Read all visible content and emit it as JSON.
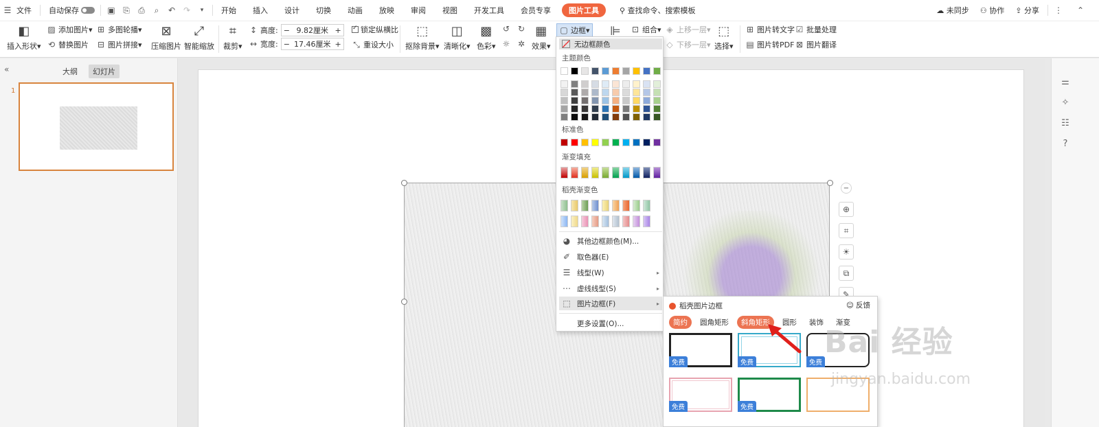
{
  "menubar": {
    "file": "文件",
    "autosave": "自动保存",
    "tabs": [
      "开始",
      "插入",
      "设计",
      "切换",
      "动画",
      "放映",
      "审阅",
      "视图",
      "开发工具",
      "会员专享",
      "图片工具"
    ],
    "search_placeholder": "查找命令、搜索模板",
    "unsynced": "未同步",
    "collab": "协作",
    "share": "分享"
  },
  "ribbon": {
    "insert_shape": "插入形状",
    "add_picture": "添加图片",
    "replace_picture": "替换图片",
    "multi_carousel": "多图轮播",
    "picture_mosaic": "图片拼接",
    "compress": "压缩图片",
    "smart_zoom": "智能缩放",
    "crop": "裁剪",
    "height_label": "高度:",
    "height_value": "9.82厘米",
    "width_label": "宽度:",
    "width_value": "17.46厘米",
    "lock_ratio": "锁定纵横比",
    "reset_size": "重设大小",
    "remove_bg": "抠除背景",
    "sharpen": "清晰化",
    "color": "色彩",
    "effects": "效果",
    "border": "边框",
    "combine": "组合",
    "bring_forward": "上移一层",
    "send_backward": "下移一层",
    "select": "选择",
    "pic_to_text": "图片转文字",
    "batch": "批量处理",
    "pic_to_pdf": "图片转PDF",
    "pic_translate": "图片翻译"
  },
  "leftpanel": {
    "tab_outline": "大纲",
    "tab_slides": "幻灯片",
    "slide_number": "1"
  },
  "dropdown": {
    "no_border": "无边框颜色",
    "theme_colors": "主题颜色",
    "standard_colors": "标准色",
    "gradient_fill": "渐变填充",
    "docer_gradient": "稻壳渐变色",
    "other_colors": "其他边框颜色(M)...",
    "eyedropper": "取色器(E)",
    "line_type": "线型(W)",
    "dash_type": "虚线线型(S)",
    "picture_border": "图片边框(F)",
    "more_settings": "更多设置(O)...",
    "theme_top": [
      "#ffffff",
      "#000000",
      "#e7e6e6",
      "#44546a",
      "#5b9bd5",
      "#ed7d31",
      "#a5a5a5",
      "#ffc000",
      "#4472c4",
      "#70ad47"
    ],
    "theme_shades": [
      [
        "#f2f2f2",
        "#7f7f7f",
        "#d0cece",
        "#d6dce4",
        "#deebf6",
        "#fbe5d5",
        "#ededed",
        "#fff2cc",
        "#d9e2f3",
        "#e2efd9"
      ],
      [
        "#d8d8d8",
        "#595959",
        "#aeaaaa",
        "#adb9ca",
        "#bdd7ee",
        "#f7cbac",
        "#dbdbdb",
        "#fee599",
        "#b4c6e7",
        "#c5e0b3"
      ],
      [
        "#bfbfbf",
        "#3f3f3f",
        "#757070",
        "#8496b0",
        "#9cc3e5",
        "#f4b183",
        "#c9c9c9",
        "#ffd965",
        "#8eaadb",
        "#a8d08d"
      ],
      [
        "#a5a5a5",
        "#262626",
        "#3a3838",
        "#323f4f",
        "#2e75b5",
        "#c55a11",
        "#7b7b7b",
        "#bf9000",
        "#2f5496",
        "#538135"
      ],
      [
        "#7f7f7f",
        "#0c0c0c",
        "#171616",
        "#222a35",
        "#1e4e79",
        "#833c0b",
        "#525252",
        "#7f6000",
        "#1f3864",
        "#375623"
      ]
    ],
    "standard": [
      "#c00000",
      "#ff0000",
      "#ffc000",
      "#ffff00",
      "#92d050",
      "#00b050",
      "#00b0f0",
      "#0070c0",
      "#002060",
      "#7030a0"
    ],
    "gradients": [
      [
        "#e8a0a0",
        "#c00000"
      ],
      [
        "#f7b0a0",
        "#e03020"
      ],
      [
        "#f3d38a",
        "#d7a000"
      ],
      [
        "#f0ec90",
        "#c8c000"
      ],
      [
        "#c8e09a",
        "#78a830"
      ],
      [
        "#8ad6a4",
        "#00a050"
      ],
      [
        "#8ad6ec",
        "#0098c8"
      ],
      [
        "#90b8e0",
        "#0058a8"
      ],
      [
        "#8090b8",
        "#102060"
      ],
      [
        "#b890d8",
        "#6020a0"
      ]
    ],
    "docer_row1": [
      [
        "#c9e2c9",
        "#8fbf8f"
      ],
      [
        "#f6e7b0",
        "#e9c96a"
      ],
      [
        "#b9d3a8",
        "#6e9e55"
      ],
      [
        "#b8cbe9",
        "#6f8fcf"
      ],
      [
        "#fbf1b5",
        "#e8d27a"
      ],
      [
        "#f8d5a4",
        "#f0a055"
      ],
      [
        "#f6a37a",
        "#e8662f"
      ],
      [
        "#d6ecd0",
        "#9acb8a"
      ],
      [
        "#cfe7d9",
        "#8ec4a3"
      ]
    ],
    "docer_row2": [
      [
        "#cfe2fb",
        "#8bb6f2"
      ],
      [
        "#fbf1c4",
        "#efd98a"
      ],
      [
        "#f6cbdc",
        "#ea93b6"
      ],
      [
        "#f6cfc0",
        "#e49a85"
      ],
      [
        "#d8e6f3",
        "#a4c0dd"
      ],
      [
        "#dfe6ee",
        "#b3c1cf"
      ],
      [
        "#f4c5c5",
        "#e38b8b"
      ],
      [
        "#e6d1f0",
        "#c38fdb"
      ],
      [
        "#d7c6f4",
        "#a985e6"
      ]
    ]
  },
  "subpanel": {
    "title": "稻壳图片边框",
    "feedback": "反馈",
    "tabs": [
      "简约",
      "圆角矩形",
      "斜角矩形",
      "圆形",
      "装饰",
      "渐变"
    ],
    "badge": "免费"
  },
  "watermark": {
    "main": "Bai 经验",
    "url": "jingyan.baidu.com"
  }
}
